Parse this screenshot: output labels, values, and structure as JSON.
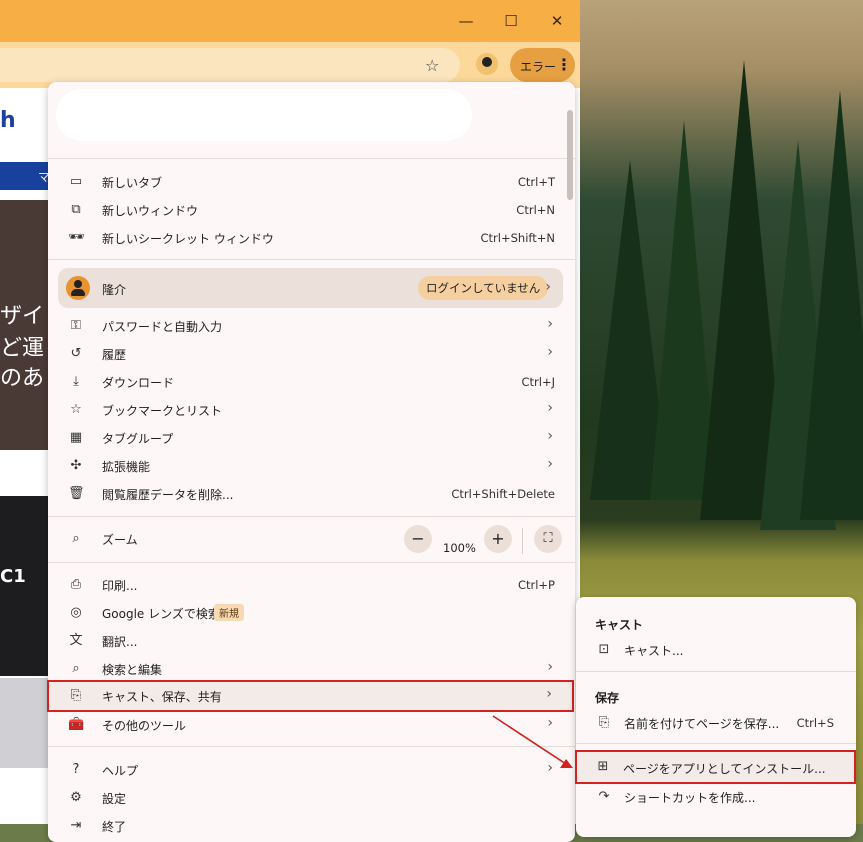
{
  "titlebar": {
    "minimize": "—",
    "maximize": "☐",
    "close": "✕"
  },
  "toolbar": {
    "profile_error_label": "エラー",
    "menu_kebab": "⋮",
    "star": "☆"
  },
  "page_behind": {
    "logo_fragment": "h",
    "nav_fragment": "マ",
    "hero_lines": [
      "ザイ",
      "ど運",
      "のあ"
    ],
    "thumb_text": "C1"
  },
  "menu": {
    "new_items": [
      {
        "icon": "new-tab-icon",
        "label": "新しいタブ",
        "shortcut": "Ctrl+T"
      },
      {
        "icon": "new-window-icon",
        "label": "新しいウィンドウ",
        "shortcut": "Ctrl+N"
      },
      {
        "icon": "incognito-icon",
        "label": "新しいシークレット ウィンドウ",
        "shortcut": "Ctrl+Shift+N"
      }
    ],
    "profile": {
      "name": "隆介",
      "status": "ログインしていません"
    },
    "group2": [
      {
        "label": "パスワードと自動入力",
        "shortcut": ""
      },
      {
        "label": "履歴",
        "shortcut": ""
      },
      {
        "label": "ダウンロード",
        "shortcut": "Ctrl+J"
      },
      {
        "label": "ブックマークとリスト",
        "shortcut": ""
      },
      {
        "label": "タブグループ",
        "shortcut": ""
      },
      {
        "label": "拡張機能",
        "shortcut": ""
      },
      {
        "label": "閲覧履歴データを削除...",
        "shortcut": "Ctrl+Shift+Delete"
      }
    ],
    "zoom": {
      "label": "ズーム",
      "minus": "−",
      "value": "100%",
      "plus": "+"
    },
    "group4": [
      {
        "label": "印刷...",
        "shortcut": "Ctrl+P"
      },
      {
        "label": "Google レンズで検索",
        "shortcut": "",
        "badge": "新規"
      },
      {
        "label": "翻訳...",
        "shortcut": ""
      },
      {
        "label": "検索と編集",
        "shortcut": ""
      },
      {
        "label": "キャスト、保存、共有",
        "shortcut": ""
      },
      {
        "label": "その他のツール",
        "shortcut": ""
      }
    ],
    "group5": [
      {
        "label": "ヘルプ"
      },
      {
        "label": "設定"
      },
      {
        "label": "終了"
      }
    ],
    "chevron": "›"
  },
  "submenu": {
    "cast_header": "キャスト",
    "cast_item": "キャスト...",
    "save_header": "保存",
    "save_page": "名前を付けてページを保存...",
    "save_page_shortcut": "Ctrl+S",
    "install_app": "ページをアプリとしてインストール...",
    "create_shortcut": "ショートカットを作成..."
  },
  "colors": {
    "titlebar": "#f6ae45",
    "toolbar": "#fcd89b",
    "highlight_border": "#d42222",
    "menu_bg": "#fdf8f7"
  }
}
